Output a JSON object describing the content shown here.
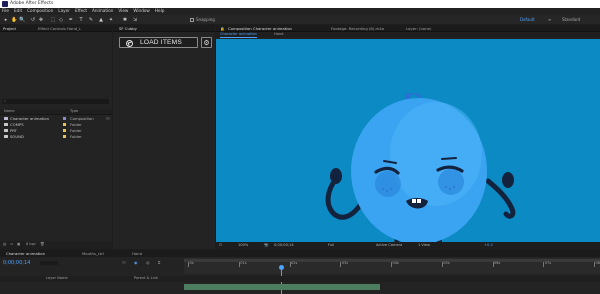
{
  "window": {
    "title": "Adobe After Effects"
  },
  "menu": [
    "File",
    "Edit",
    "Composition",
    "Layer",
    "Effect",
    "Animation",
    "View",
    "Window",
    "Help"
  ],
  "toolbar": {
    "tools": [
      "▸",
      "✋",
      "🔍",
      "↺",
      "✥",
      "⬚",
      "◇",
      "✒",
      "T",
      "✎",
      "▲",
      "✦",
      "✱",
      "⇲"
    ],
    "snapping_label": "Snapping",
    "workspace_default": "Default",
    "workspace_standard": "Standard"
  },
  "project": {
    "tabs": [
      "Project",
      "Effect Controls Hand_L"
    ],
    "search_icon": "search-icon",
    "columns": {
      "name": "Name",
      "type": "Type"
    },
    "items": [
      {
        "name": "Character animation",
        "type": "Composition",
        "swatch": "#8c8cc8",
        "kind": "comp"
      },
      {
        "name": "COMPS",
        "type": "Folder",
        "swatch": "#e8c35a",
        "kind": "folder"
      },
      {
        "name": "PRT",
        "type": "Folder",
        "swatch": "#e8c35a",
        "kind": "folder"
      },
      {
        "name": "SOUND",
        "type": "Folder",
        "swatch": "#e8c35a",
        "kind": "folder"
      }
    ],
    "bpc": "8 bpc"
  },
  "sfx": {
    "tab": "SF Cubby",
    "load_button": "LOAD ITEMS",
    "gear_icon": "gear-icon"
  },
  "comp": {
    "tabs": [
      "Composition Character animation",
      "Footage: Recording (8).m4a",
      "Layer: (none)"
    ],
    "subtabs": [
      "Character animation",
      "Hand"
    ],
    "bg_color": "#0b8ac3",
    "bottom": {
      "zoom": "100%",
      "time": "0;00;00;14",
      "quality": "Full",
      "camera": "Active Camera",
      "view": "1 View",
      "offset": "+0.0"
    }
  },
  "timeline": {
    "tabs": [
      "Character animation",
      "Mouths_ctrl",
      "Hand"
    ],
    "timecode": "0;00;00;14",
    "columns": {
      "layer_name": "Layer Name",
      "parent": "Parent & Link"
    },
    "ruler": [
      "0s",
      "01s",
      "02s",
      "03s",
      "04s",
      "05s",
      "06s",
      "07s",
      "08s"
    ],
    "playhead_fraction": 0.23
  }
}
